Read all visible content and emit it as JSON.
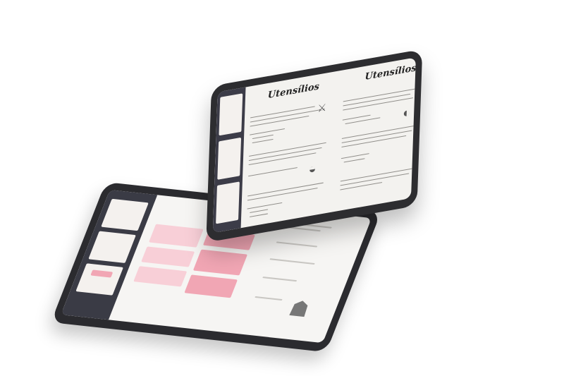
{
  "front_tablet": {
    "left_page_title": "Utensílios",
    "right_page_title": "Utensílios"
  },
  "icons": {
    "knife": "knife-icon",
    "whisk_bowl": "bowl-icon",
    "pan": "pan-icon",
    "chef_hat": "chef-hat-icon"
  },
  "colors": {
    "device_frame": "#2d2d30",
    "sidebar": "#3c3c48",
    "accent_pink": "#f1a6b4"
  }
}
